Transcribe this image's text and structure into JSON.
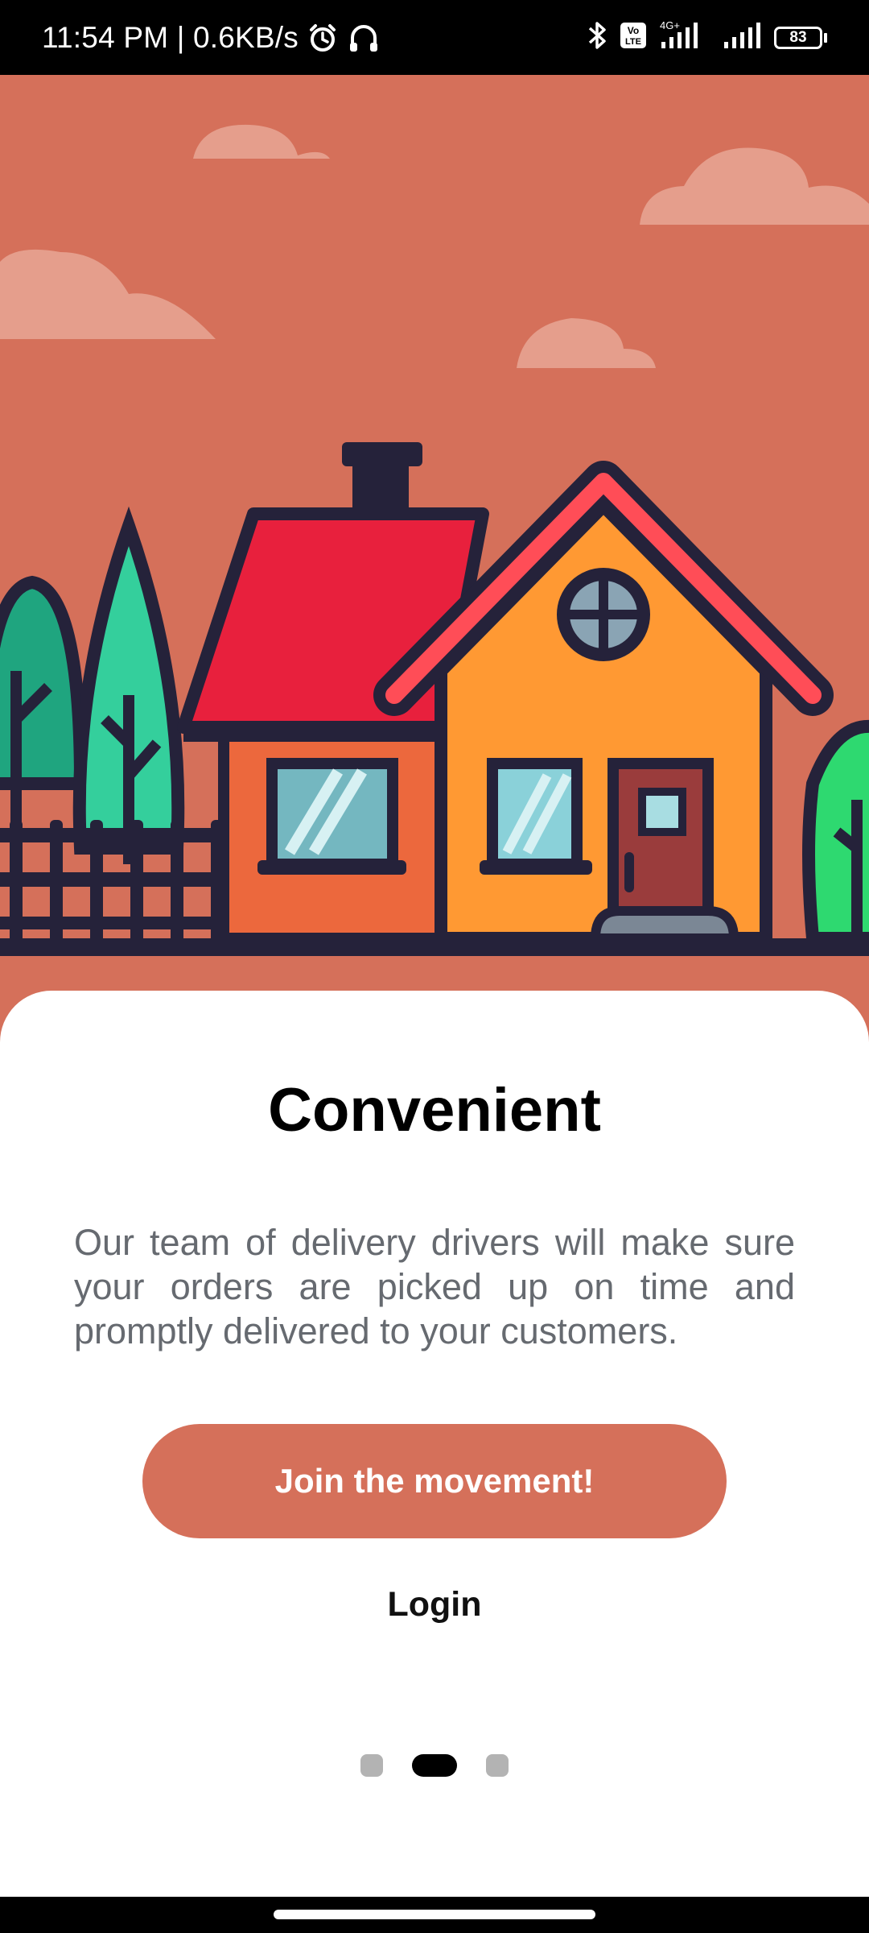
{
  "status_bar": {
    "time_speed": "11:54 PM | 0.6KB/s",
    "alarm_icon": "alarm-icon",
    "headset_icon": "headset-icon",
    "bluetooth_icon": "bluetooth-icon",
    "volte_badge": "Vo LTE",
    "network_label": "4G+",
    "battery_level": "83"
  },
  "onboarding": {
    "title": "Convenient",
    "description": "Our team of delivery drivers will make sure your orders are picked up on time and promptly delivered to your customers.",
    "primary_button": "Join the movement!",
    "secondary_link": "Login",
    "pager": {
      "pages": 3,
      "active_index": 1
    }
  },
  "colors": {
    "accent": "#d5705a",
    "roof_red": "#e8203d",
    "house_orange": "#ff9933",
    "tree_green": "#34cf9c",
    "outline": "#25223a"
  }
}
